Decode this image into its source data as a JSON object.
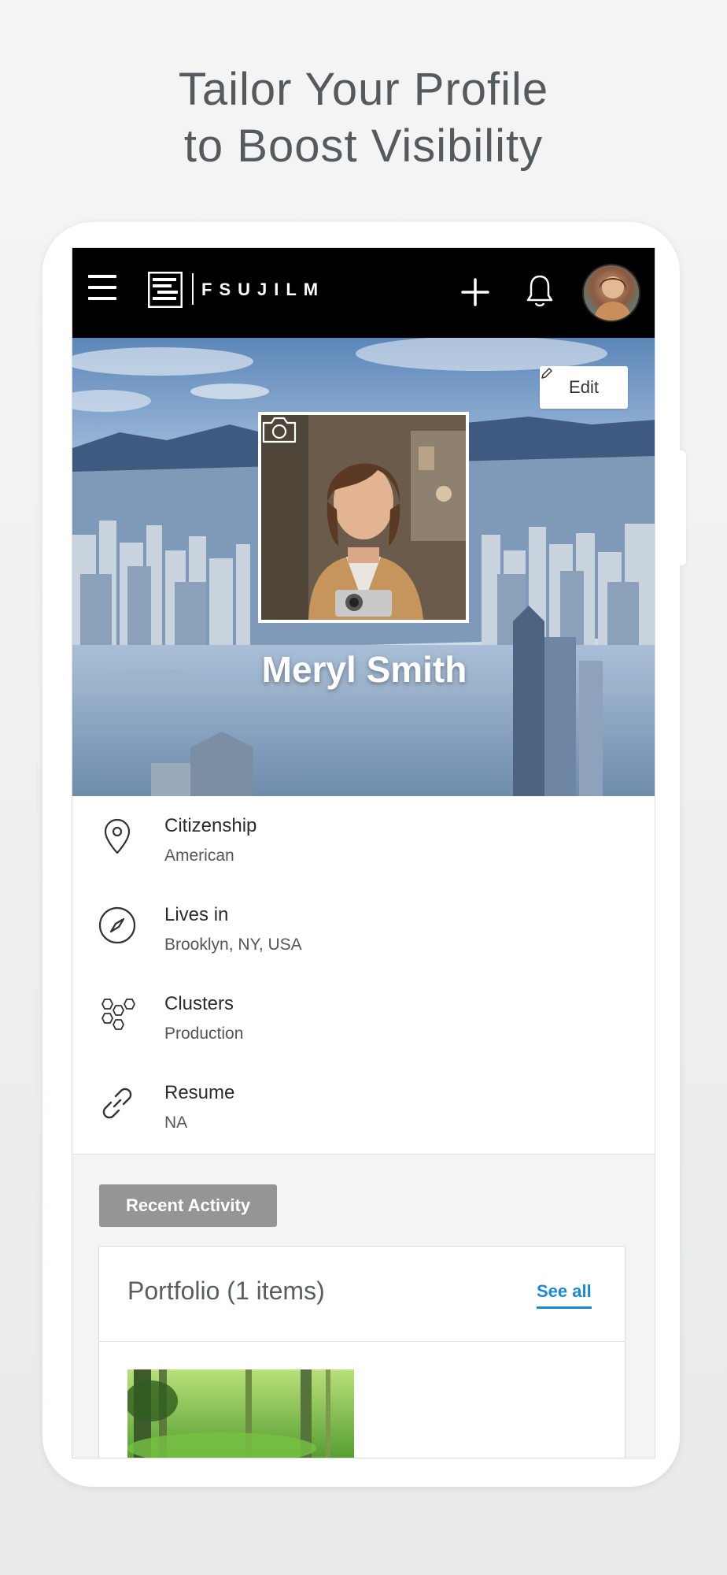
{
  "headline": {
    "line1": "Tailor Your Profile",
    "line2": "to Boost Visibility"
  },
  "topbar": {
    "logo_text": "FSUJILM",
    "menu_icon": "hamburger-menu-icon",
    "add_icon": "plus-icon",
    "notifications_icon": "bell-icon"
  },
  "hero": {
    "edit_label": "Edit",
    "name": "Meryl Smith",
    "camera_icon": "camera-icon"
  },
  "info": [
    {
      "label": "Citizenship",
      "value": "American",
      "icon": "location-pin-icon"
    },
    {
      "label": "Lives in",
      "value": "Brooklyn, NY, USA",
      "icon": "compass-icon"
    },
    {
      "label": "Clusters",
      "value": "Production",
      "icon": "hexagon-cluster-icon"
    },
    {
      "label": "Resume",
      "value": "NA",
      "icon": "link-icon"
    }
  ],
  "activity": {
    "recent_activity_label": "Recent Activity",
    "portfolio_title": "Portfolio (1 items)",
    "see_all_label": "See all"
  },
  "colors": {
    "topbar_bg": "#000000",
    "accent_link": "#1a8ad4",
    "recent_activity_bg": "#939596"
  }
}
